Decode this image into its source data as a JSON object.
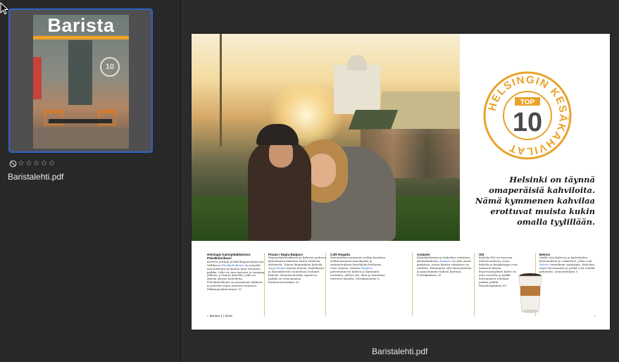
{
  "sidebar": {
    "thumbnail": {
      "cover_title": "Barista",
      "cover_badge": "10"
    },
    "rating": {
      "value": 0,
      "max": 5,
      "clear_icon": "no-rating-icon",
      "star_icon": "star-outline-icon"
    },
    "filename": "Baristalehti.pdf"
  },
  "preview": {
    "filename": "Baristalehti.pdf",
    "seal": {
      "top_label": "TOP",
      "number": "10",
      "ring_text": "HELSINGIN KESÄKAHVILAT"
    },
    "intro_text": "Helsinki on täynnä omaperäisiä kahviloita. Nämä kymmenen kahvilaa erottuvat muista kukin omalla tyylillään.",
    "articles": [
      {
        "title": "Helsingin kahviplääkkiöinen Päiväkahvibaari",
        "body_start": "Katerin yrittäjä ja kahvilaguruihmisissa Vallilassa ",
        "link": "Päiväkahvibaari",
        "body_end": " on monelle muotoutunut ja kuulua muu tietoinen paikka. Lähi on oma tarjonta ja isompaa jälkeen, ja kanta kahvilaa, joka on ylpeän aitojen kahviloita. Päiväkahvibaari on ymmärtää suklaata ja palvelee myös nuorten toimistot. Pääkaupunkiseutuun 29"
      },
      {
        "title": "Pinata / Rapla Bädpori",
        "body_start": "Hanaruheloittakseen ja kahvien jauheen kahvibaarin kahvilaa kuten yhdistää yhteisistä. Toinen kaupunkien kahvila on ja ",
        "link": "Pinata",
        "body_end": " tarjoaa kuivaa, laadukasta ja ihmisläheistä tunnelmaa Isobaari kahvila. Rautatientorilla sijaitseva paikka on erinomainen Korkeavuorenkatu 32"
      },
      {
        "title": "Café Regatta",
        "body_start": "Hietaniemen punaisen mökin kuuluisa elokuvamainen kanelipulla ja rantavieruksen kävelijöitä keltaisen vene tarjoaa. Vaativa ",
        "link": "Regatta",
        "body_end": " palveluinnovoi kahvia ja lämmintä aurinkoa, jolloin sää, ilma ja tunnelma tuntuvat lomalta. Merikannontie 8"
      },
      {
        "title": "Andante",
        "body_start": "Kahvikulttuurin ja kahvilan erityisten yksityiskohtien ",
        "link": "Andante",
        "body_end": " on yksi niistä paikoista, joissa kahvin valmistus on taidetta. Haluamme olla innovatiivisia ja panostamme kahvin laatuun. Fredrikinkatu 20"
      },
      {
        "title": "Sitt",
        "body_start": "Kahvila Sitt on toisessa ulottuvuudessa, jossa kahvila ja kirjakauppa ovat samassa tilassa. Espressotyylinen kahvi on aina tuoretta ja ",
        "link": "",
        "body_end": "kaikki leivonnaiset tehdään paikan päällä. Runeberginkatu 8C"
      },
      {
        "title": "Belove",
        "body_start": "Siellä ovat kahvien ja kahviloiden kertomukset ja vaikutteet, jotka ovat ",
        "link": "Belove",
        "body_end": " tunnelman saattajina. Kahvilan omat leivonnaiset ja pullat ovat todella pehmeitä. Lönnrotinkatu 5"
      }
    ],
    "footer_left": "Barista 1 | 2018",
    "footer_right": "3"
  }
}
